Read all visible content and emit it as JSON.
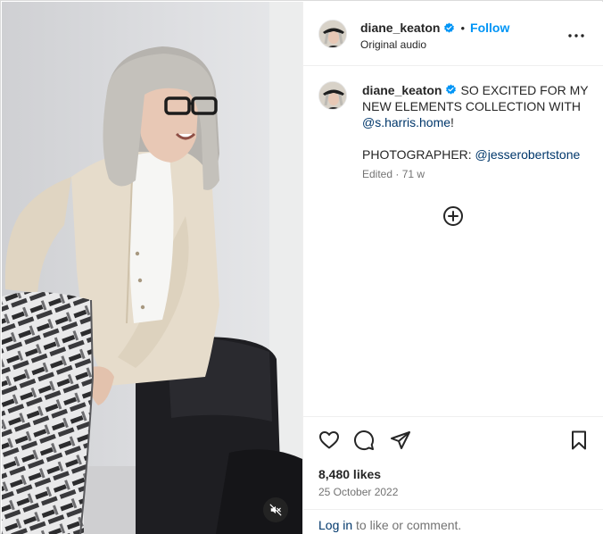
{
  "post": {
    "author": {
      "username": "diane_keaton",
      "verified_icon": "verified-badge-icon",
      "avatar_icon": "profile-avatar"
    },
    "header": {
      "separator": "•",
      "follow_label": "Follow",
      "audio_label": "Original audio",
      "more_icon": "more-options-icon"
    },
    "caption": {
      "text_part1": "SO EXCITED FOR MY NEW ELEMENTS COLLECTION WITH ",
      "mention1": "@s.harris.home",
      "text_part2": "!",
      "photographer_label": "PHOTOGRAPHER: ",
      "mention2": "@jesserobertstone",
      "edited_label": "Edited",
      "meta_separator": " · ",
      "age": "71 w"
    },
    "add_comment_icon": "add-circle-icon",
    "actions": {
      "like_icon": "heart-icon",
      "comment_icon": "comment-icon",
      "share_icon": "paper-plane-icon",
      "save_icon": "bookmark-icon"
    },
    "likes": "8,480 likes",
    "date": "25 October 2022",
    "login_link": "Log in",
    "login_suffix": " to like or comment."
  },
  "media": {
    "mute_icon": "speaker-muted-icon"
  },
  "colors": {
    "accent": "#0095f6",
    "link": "#00376b",
    "text": "#262626",
    "secondary": "#737373",
    "border": "#efefef",
    "verified": "#0095f6"
  }
}
